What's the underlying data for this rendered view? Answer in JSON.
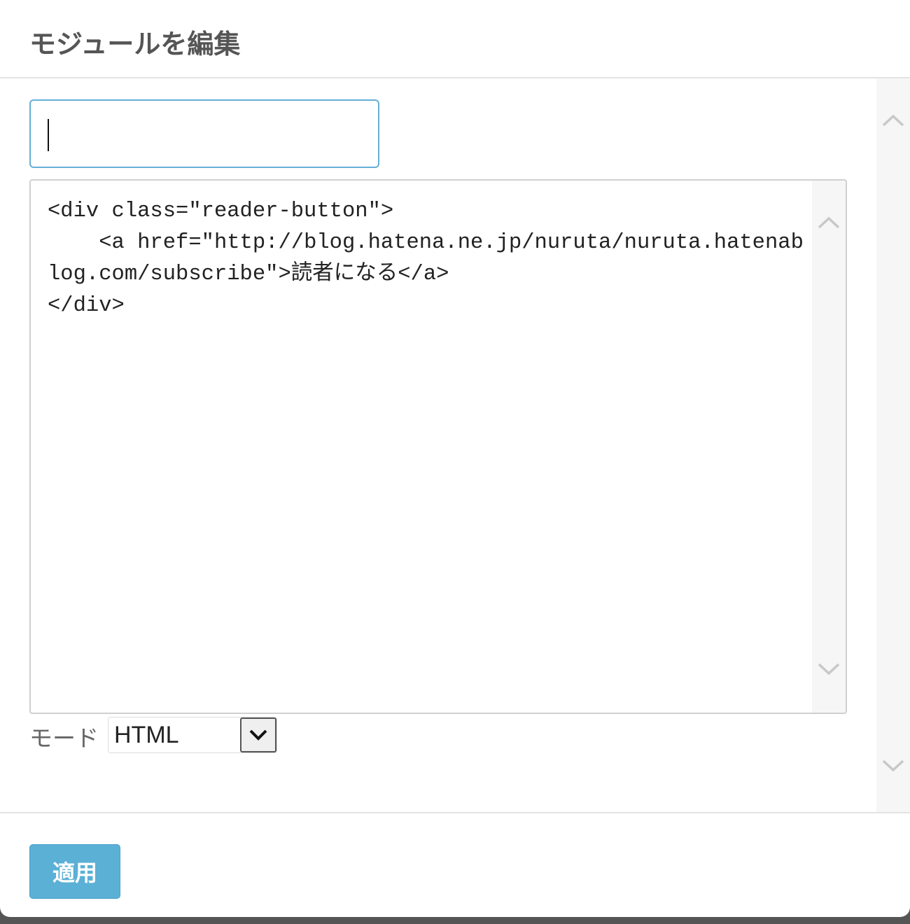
{
  "dialog": {
    "title": "モジュールを編集"
  },
  "title_input": {
    "value": "",
    "placeholder": ""
  },
  "editor": {
    "content": "<div class=\"reader-button\">\n    <a href=\"http://blog.hatena.ne.jp/nuruta/nuruta.hatenablog.com/subscribe\">読者になる</a>\n</div>"
  },
  "mode": {
    "label": "モード",
    "selected": "HTML"
  },
  "footer": {
    "apply_label": "適用"
  },
  "icons": {
    "scroll_up": "chevron-up-icon",
    "scroll_down": "chevron-down-icon",
    "select_arrow": "chevron-down-icon"
  },
  "colors": {
    "accent": "#5bb0d6",
    "input_focus_border": "#66afd6"
  }
}
